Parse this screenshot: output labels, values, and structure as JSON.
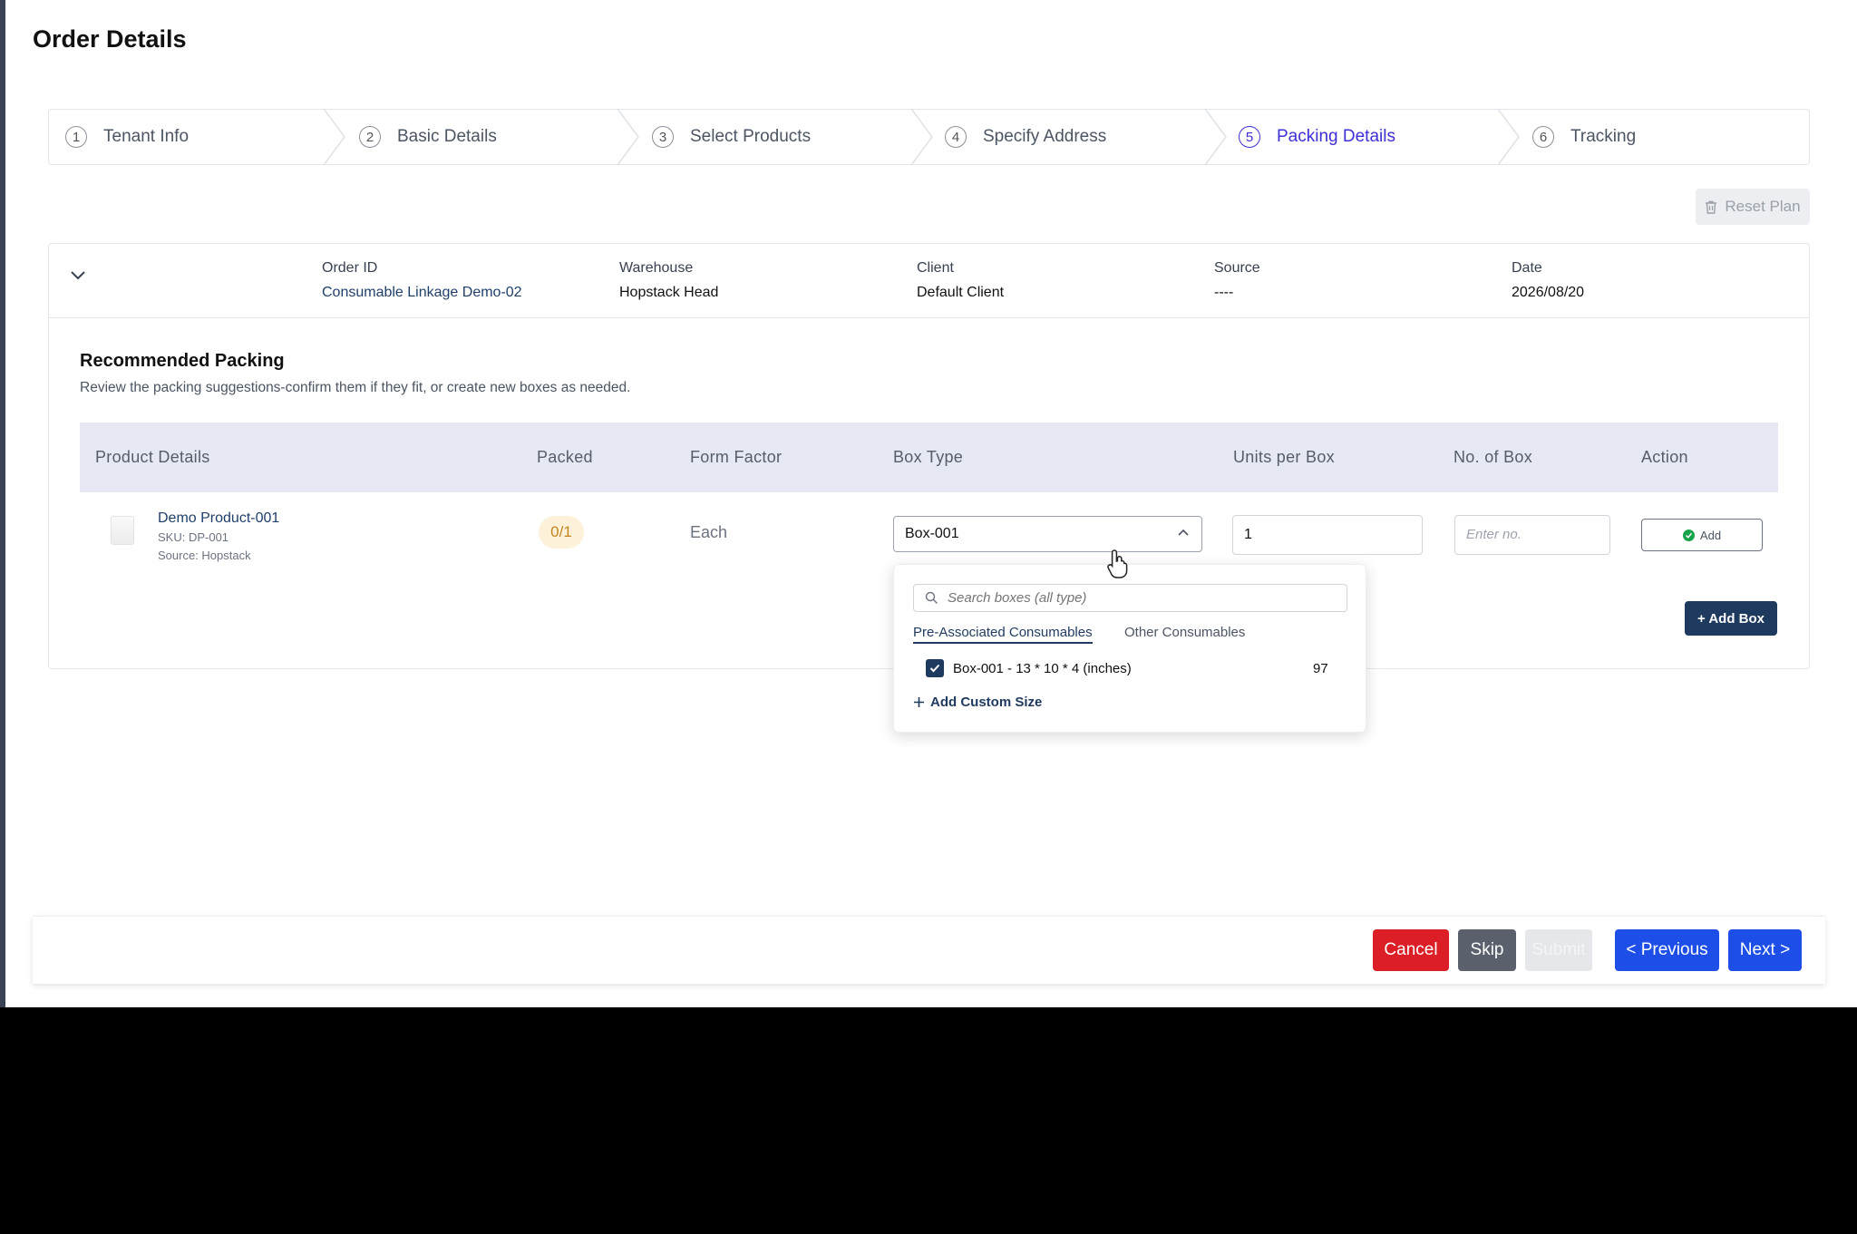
{
  "page": {
    "title": "Order Details"
  },
  "stepper": {
    "steps": [
      {
        "num": "1",
        "label": "Tenant Info"
      },
      {
        "num": "2",
        "label": "Basic Details"
      },
      {
        "num": "3",
        "label": "Select Products"
      },
      {
        "num": "4",
        "label": "Specify Address"
      },
      {
        "num": "5",
        "label": "Packing Details"
      },
      {
        "num": "6",
        "label": "Tracking"
      }
    ],
    "active_step": 5
  },
  "toolbar": {
    "reset_label": "Reset Plan"
  },
  "order": {
    "order_id_label": "Order ID",
    "order_id": "Consumable Linkage Demo-02",
    "warehouse_label": "Warehouse",
    "warehouse": "Hopstack Head",
    "client_label": "Client",
    "client": "Default Client",
    "source_label": "Source",
    "source": "----",
    "date_label": "Date",
    "date": "2026/08/20"
  },
  "packing": {
    "title": "Recommended Packing",
    "subtitle": "Review the packing suggestions-confirm them if they fit, or create new boxes as needed.",
    "columns": [
      "Product Details",
      "Packed",
      "Form Factor",
      "Box Type",
      "Units per Box",
      "No. of Box",
      "Action"
    ],
    "row": {
      "product_name": "Demo Product-001",
      "sku": "SKU: DP-001",
      "source": "Source: Hopstack",
      "packed": "0/1",
      "form_factor": "Each",
      "box_type": "Box-001",
      "units_per_box": "1",
      "no_of_box_placeholder": "Enter no.",
      "action_label": "Add"
    },
    "add_box_label": "+ Add Box"
  },
  "dropdown": {
    "search_placeholder": "Search boxes (all type)",
    "tabs": [
      "Pre-Associated Consumables",
      "Other Consumables"
    ],
    "active_tab": "Pre-Associated Consumables",
    "options": [
      {
        "label": "Box-001 - 13 * 10 * 4 (inches)",
        "count": "97",
        "checked": true
      }
    ],
    "add_custom_label": "Add Custom Size"
  },
  "footer": {
    "cancel": "Cancel",
    "skip": "Skip",
    "submit": "Submit",
    "previous": "< Previous",
    "next": "Next >"
  },
  "colors": {
    "accent": "#3d2fd6",
    "primary_button": "#1d4ee8",
    "danger": "#dc1f26",
    "navy": "#1e3a5f"
  },
  "icons": [
    "chevron-down-icon",
    "trash-icon",
    "chevron-up-icon",
    "check-circle-icon",
    "search-icon",
    "checkbox-checked-icon",
    "plus-icon",
    "hand-cursor-icon"
  ]
}
